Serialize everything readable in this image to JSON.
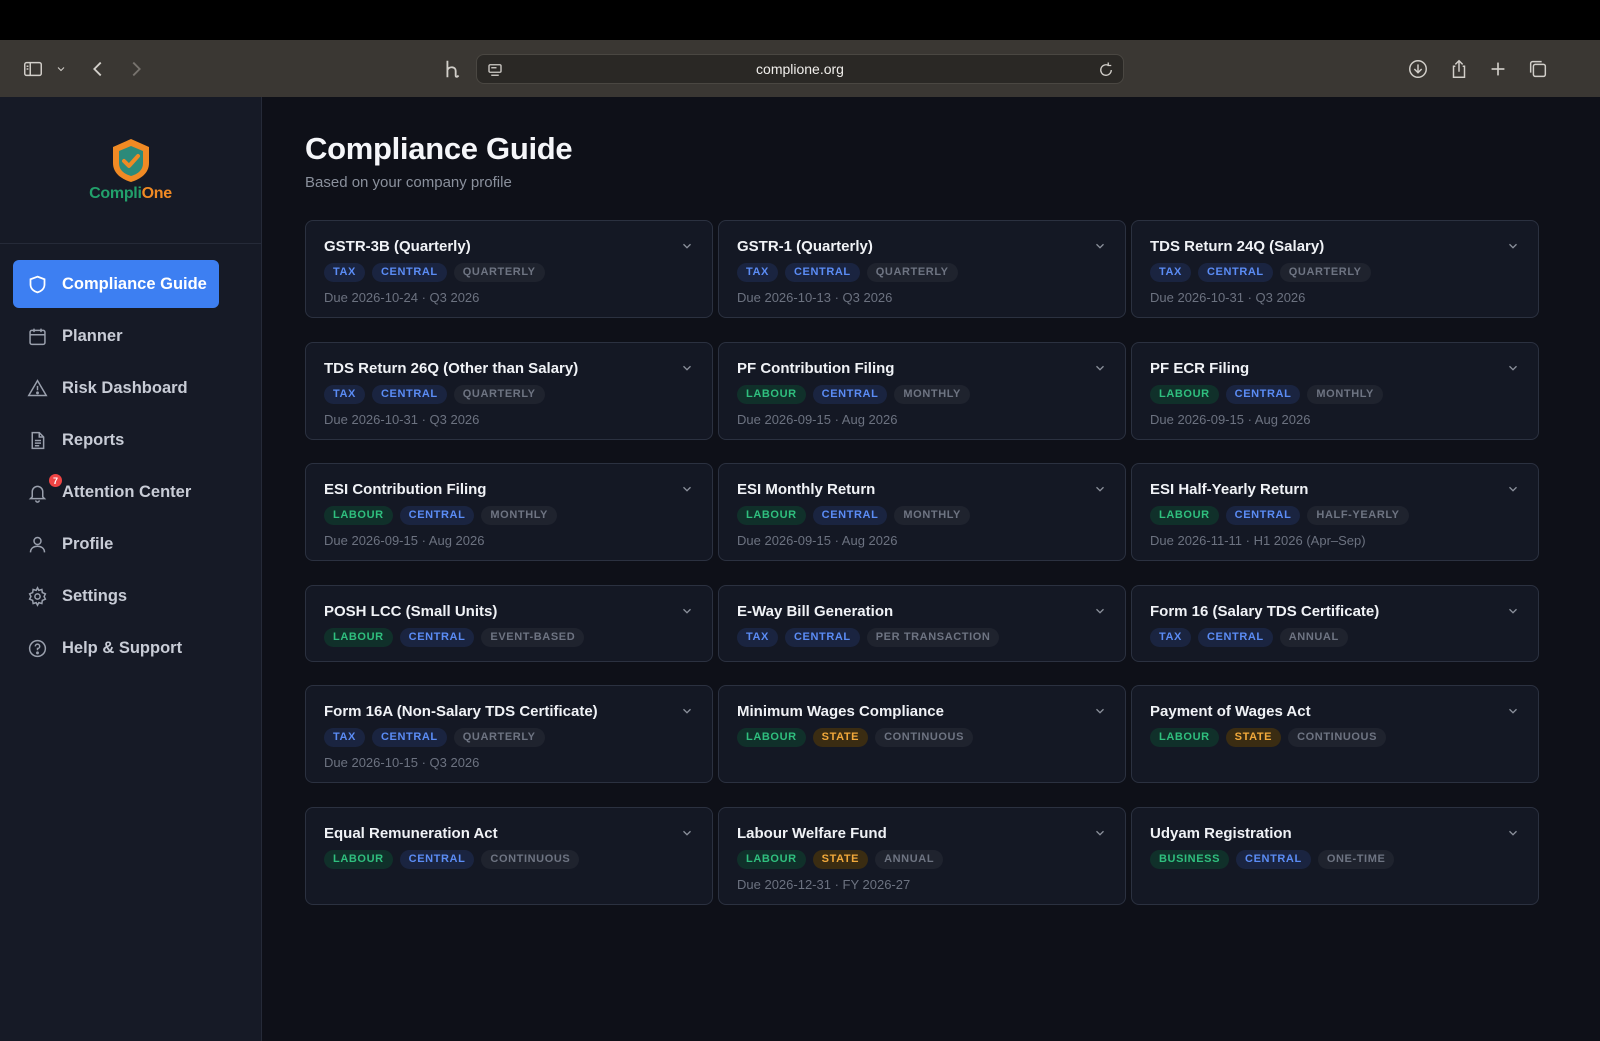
{
  "browser": {
    "url": "complione.org"
  },
  "brand": {
    "name_part1": "Compli",
    "name_part2": "One",
    "green": "#22a06b",
    "orange": "#f08a24"
  },
  "sidebar": {
    "items": [
      {
        "label": "Compliance Guide",
        "icon": "shield-icon",
        "active": true
      },
      {
        "label": "Planner",
        "icon": "calendar-icon"
      },
      {
        "label": "Risk Dashboard",
        "icon": "warning-icon"
      },
      {
        "label": "Reports",
        "icon": "document-icon"
      },
      {
        "label": "Attention Center",
        "icon": "bell-icon",
        "badge": "7"
      },
      {
        "label": "Profile",
        "icon": "user-icon"
      },
      {
        "label": "Settings",
        "icon": "gear-icon"
      },
      {
        "label": "Help & Support",
        "icon": "help-icon"
      }
    ]
  },
  "main": {
    "title": "Compliance Guide",
    "subtitle": "Based on your company profile",
    "accent": "#3d7ff2",
    "cards": [
      {
        "title": "GSTR-3B (Quarterly)",
        "tags": [
          "TAX",
          "CENTRAL",
          "QUARTERLY"
        ],
        "due": "Due 2026-10-24 · Q3 2026"
      },
      {
        "title": "GSTR-1 (Quarterly)",
        "tags": [
          "TAX",
          "CENTRAL",
          "QUARTERLY"
        ],
        "due": "Due 2026-10-13 · Q3 2026"
      },
      {
        "title": "TDS Return 24Q (Salary)",
        "tags": [
          "TAX",
          "CENTRAL",
          "QUARTERLY"
        ],
        "due": "Due 2026-10-31 · Q3 2026"
      },
      {
        "title": "TDS Return 26Q (Other than Salary)",
        "tags": [
          "TAX",
          "CENTRAL",
          "QUARTERLY"
        ],
        "due": "Due 2026-10-31 · Q3 2026"
      },
      {
        "title": "PF Contribution Filing",
        "tags": [
          "LABOUR",
          "CENTRAL",
          "MONTHLY"
        ],
        "due": "Due 2026-09-15 · Aug 2026"
      },
      {
        "title": "PF ECR Filing",
        "tags": [
          "LABOUR",
          "CENTRAL",
          "MONTHLY"
        ],
        "due": "Due 2026-09-15 · Aug 2026"
      },
      {
        "title": "ESI Contribution Filing",
        "tags": [
          "LABOUR",
          "CENTRAL",
          "MONTHLY"
        ],
        "due": "Due 2026-09-15 · Aug 2026"
      },
      {
        "title": "ESI Monthly Return",
        "tags": [
          "LABOUR",
          "CENTRAL",
          "MONTHLY"
        ],
        "due": "Due 2026-09-15 · Aug 2026"
      },
      {
        "title": "ESI Half-Yearly Return",
        "tags": [
          "LABOUR",
          "CENTRAL",
          "HALF-YEARLY"
        ],
        "due": "Due 2026-11-11 · H1 2026 (Apr–Sep)"
      },
      {
        "title": "POSH LCC (Small Units)",
        "tags": [
          "LABOUR",
          "CENTRAL",
          "EVENT-BASED"
        ],
        "due": ""
      },
      {
        "title": "E-Way Bill Generation",
        "tags": [
          "TAX",
          "CENTRAL",
          "PER TRANSACTION"
        ],
        "due": ""
      },
      {
        "title": "Form 16 (Salary TDS Certificate)",
        "tags": [
          "TAX",
          "CENTRAL",
          "ANNUAL"
        ],
        "due": ""
      },
      {
        "title": "Form 16A (Non-Salary TDS Certificate)",
        "tags": [
          "TAX",
          "CENTRAL",
          "QUARTERLY"
        ],
        "due": "Due 2026-10-15 · Q3 2026"
      },
      {
        "title": "Minimum Wages Compliance",
        "tags": [
          "LABOUR",
          "STATE",
          "CONTINUOUS"
        ],
        "due": ""
      },
      {
        "title": "Payment of Wages Act",
        "tags": [
          "LABOUR",
          "STATE",
          "CONTINUOUS"
        ],
        "due": ""
      },
      {
        "title": "Equal Remuneration Act",
        "tags": [
          "LABOUR",
          "CENTRAL",
          "CONTINUOUS"
        ],
        "due": ""
      },
      {
        "title": "Labour Welfare Fund",
        "tags": [
          "LABOUR",
          "STATE",
          "ANNUAL"
        ],
        "due": "Due 2026-12-31 · FY 2026-27"
      },
      {
        "title": "Udyam Registration",
        "tags": [
          "BUSINESS",
          "CENTRAL",
          "ONE-TIME"
        ],
        "due": ""
      }
    ]
  }
}
